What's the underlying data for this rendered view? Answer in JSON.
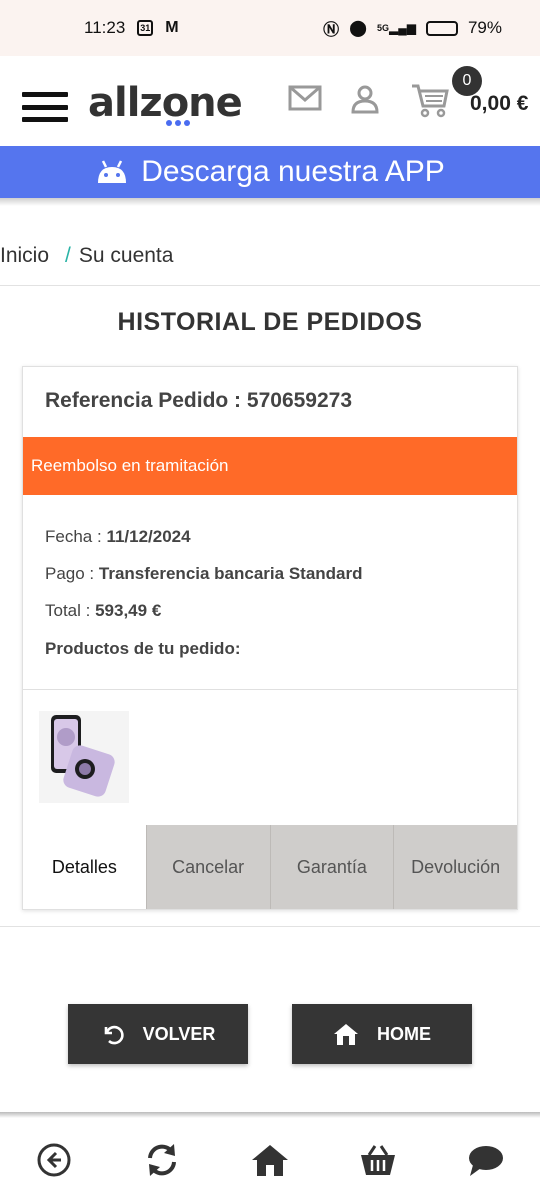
{
  "status_bar": {
    "time": "11:23",
    "calendar_day": "31",
    "mail_glyph": "M",
    "network": "5G",
    "battery_percent": "79%",
    "battery_level": 0.79
  },
  "header": {
    "logo": "allzone",
    "cart_count": "0",
    "cart_total": "0,00 €"
  },
  "banner": {
    "text": "Descarga nuestra APP"
  },
  "breadcrumb": {
    "home": "Inicio",
    "separator": "/",
    "current": "Su cuenta"
  },
  "page_title": "HISTORIAL DE PEDIDOS",
  "order": {
    "reference_label": "Referencia Pedido :",
    "reference": "570659273",
    "status": "Reembolso en tramitación",
    "status_color": "#ff6a28",
    "date_label": "Fecha :",
    "date": "11/12/2024",
    "payment_label": "Pago :",
    "payment": "Transferencia bancaria Standard",
    "total_label": "Total :",
    "total": "593,49 €",
    "products_label": "Productos de tu pedido:",
    "tabs": [
      "Detalles",
      "Cancelar",
      "Garantía",
      "Devolución"
    ]
  },
  "buttons": {
    "back": "VOLVER",
    "home": "HOME"
  },
  "colors": {
    "accent": "#5575ee",
    "button": "#353535"
  }
}
